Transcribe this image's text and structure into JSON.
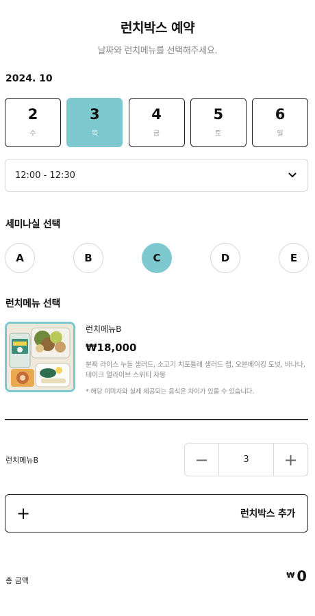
{
  "header": {
    "title": "런치박스 예약",
    "subtitle": "날짜와 런치메뉴를 선택해주세요."
  },
  "calendar": {
    "month_label": "2024. 10",
    "selected_index": 1,
    "dates": [
      {
        "num": "2",
        "day": "수"
      },
      {
        "num": "3",
        "day": "목"
      },
      {
        "num": "4",
        "day": "금"
      },
      {
        "num": "5",
        "day": "토"
      },
      {
        "num": "6",
        "day": "일"
      }
    ]
  },
  "time_select": {
    "value": "12:00 - 12:30",
    "icon": "chevron-down-icon"
  },
  "seminar": {
    "label": "세미나실 선택",
    "selected_index": 2,
    "rooms": [
      "A",
      "B",
      "C",
      "D",
      "E"
    ]
  },
  "lunch_menu": {
    "label": "런치메뉴 선택",
    "item": {
      "name": "런치메뉴B",
      "price": "₩18,000",
      "description": "분짜 라이스 누들 샐러드, 소고기 치포틀레 샐러드 랩, 오븐베이킹 도넛, 바나나, 테이크 얼라이브 스위티 자몽",
      "note": "* 해당 이미지와 실제 제공되는 음식은 차이가 있을 수 있습니다."
    }
  },
  "quantity": {
    "label": "런치메뉴B",
    "minus": "−",
    "value": "3",
    "plus": "+"
  },
  "add_button": {
    "icon": "+",
    "label": "런치박스 추가"
  },
  "total": {
    "label": "총 금액",
    "currency": "₩",
    "amount": "0"
  },
  "colors": {
    "accent": "#7ec8cf",
    "border": "#222222",
    "muted": "#8a8a8a"
  }
}
